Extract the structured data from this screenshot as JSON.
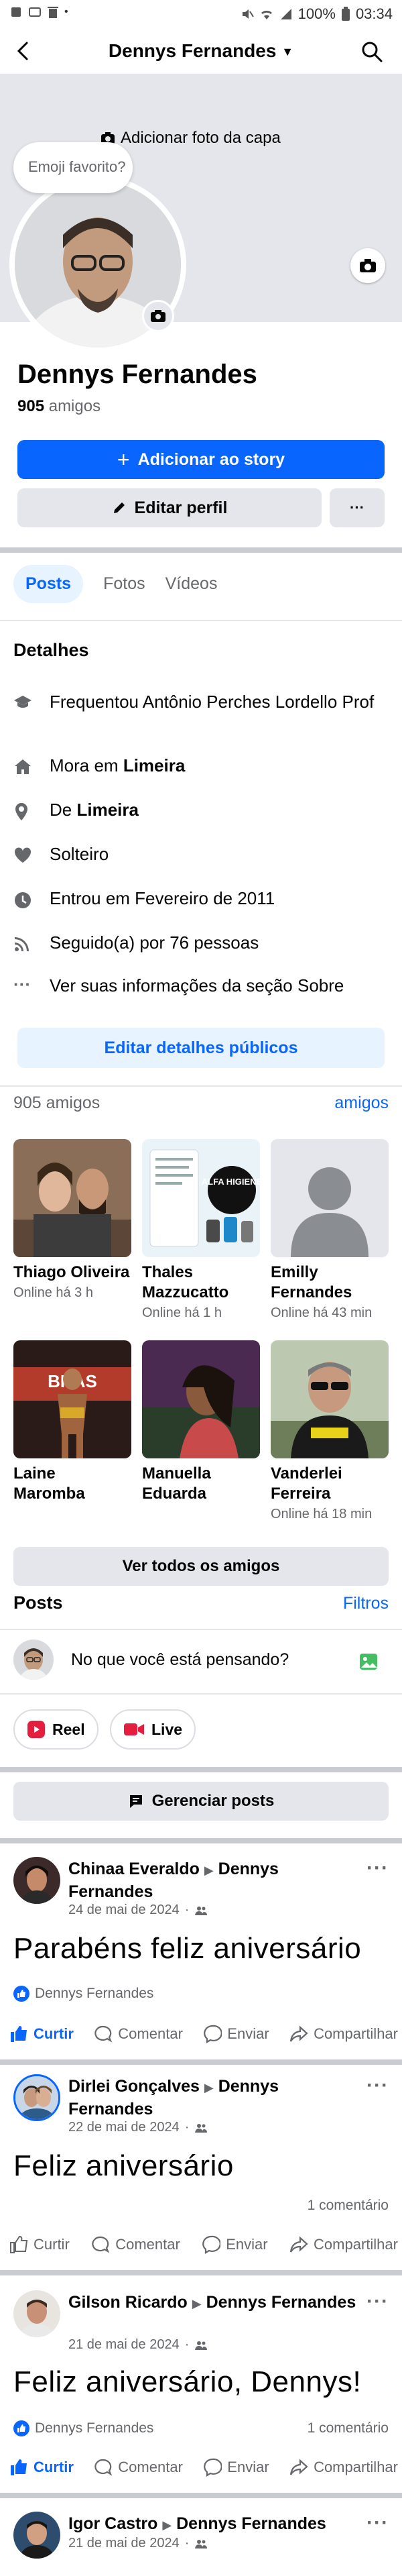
{
  "status_bar": {
    "battery": "100%",
    "time": "03:34"
  },
  "header": {
    "title": "Dennys Fernandes"
  },
  "cover": {
    "add_cover_label": "Adicionar foto da capa"
  },
  "bubble": {
    "text": "Emoji favorito?"
  },
  "profile": {
    "name": "Dennys Fernandes",
    "friends_count": "905",
    "friends_word": "amigos",
    "add_story": "Adicionar ao story",
    "edit_profile": "Editar perfil",
    "more": "···"
  },
  "tabs": [
    "Posts",
    "Fotos",
    "Vídeos"
  ],
  "details": {
    "title": "Detalhes",
    "studied": "Frequentou Antônio Perches Lordello Prof",
    "lives_prefix": "Mora em ",
    "lives_city": "Limeira",
    "from_prefix": "De ",
    "from_city": "Limeira",
    "relationship": "Solteiro",
    "joined": "Entrou em Fevereiro de 2011",
    "followers": "Seguido(a) por 76 pessoas",
    "about": "Ver suas informações da seção Sobre",
    "edit_button": "Editar detalhes públicos"
  },
  "friends": {
    "count_label": "905 amigos",
    "link": "amigos",
    "items": [
      {
        "name": "Thiago Oliveira",
        "status": "Online há 3 h"
      },
      {
        "name": "Thales Mazzucatto",
        "status": "Online há 1 h",
        "thumb_text": "ALFA HIGIENE"
      },
      {
        "name": "Emilly Fernandes",
        "status": "Online há 43 min"
      },
      {
        "name": "Laine Maromba",
        "status": "",
        "thumb_text": "BRAS"
      },
      {
        "name": "Manuella Eduarda",
        "status": ""
      },
      {
        "name": "Vanderlei Ferreira",
        "status": "Online há 18 min"
      }
    ],
    "see_all": "Ver todos os amigos"
  },
  "posts_section": {
    "title": "Posts",
    "filter": "Filtros",
    "composer_placeholder": "No que você está pensando?",
    "reel": "Reel",
    "live": "Live",
    "manage": "Gerenciar posts"
  },
  "actions": {
    "like": "Curtir",
    "comment": "Comentar",
    "send": "Enviar",
    "share": "Compartilhar"
  },
  "posts": [
    {
      "author": "Chinaa Everaldo",
      "arrow": "▶",
      "target": "Dennys Fernandes",
      "date": "24 de mai de 2024",
      "text": "Parabéns feliz aniversário",
      "likes": "Dennys Fernandes",
      "comments": "",
      "liked": true
    },
    {
      "author": "Dirlei Gonçalves",
      "arrow": "▶",
      "target": "Dennys Fernandes",
      "date": "22 de mai de 2024",
      "text": "Feliz aniversário",
      "likes": "",
      "comments": "1 comentário",
      "liked": false
    },
    {
      "author": "Gilson Ricardo",
      "arrow": "▶",
      "target": "Dennys Fernandes",
      "date": "21 de mai de 2024",
      "text": "Feliz aniversário, Dennys!",
      "likes": "Dennys Fernandes",
      "comments": "1 comentário",
      "liked": true
    },
    {
      "author": "Igor Castro",
      "arrow": "▶",
      "target": "Dennys Fernandes",
      "date": "21 de mai de 2024"
    }
  ],
  "colors": {
    "brand_blue": "#0866ff",
    "light_blue": "#e7f3ff",
    "gray_button": "#e4e6eb",
    "secondary_text": "#65676b"
  }
}
